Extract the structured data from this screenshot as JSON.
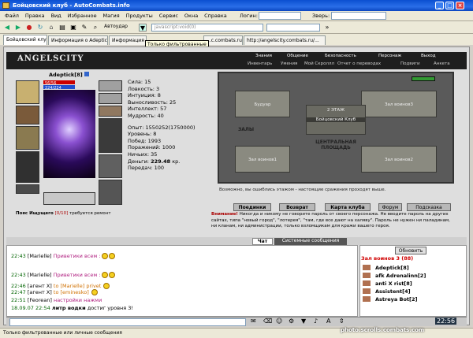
{
  "window": {
    "title": "Бойцовский клуб - AutoCombats.info"
  },
  "menu": [
    "Файл",
    "Правка",
    "Вид",
    "Избранное",
    "Магия",
    "Продукты",
    "Сервис",
    "Окна",
    "Справка"
  ],
  "toolbar": {
    "autoudar": "Автоудар",
    "url_placeholder": "javascript:void(0)",
    "login_label": "Логин:",
    "zver_label": "Зверь:"
  },
  "tabs": [
    "Бойцовский клуб",
    "Информация о Adeptick",
    "Информация о ...",
    "...c.combats.ru/...",
    "http://angelscity.combats.ru/..."
  ],
  "tooltip": "Только фильтрованные",
  "game_header": {
    "logo": "ANGELSCITY",
    "nav_top": [
      "Знания",
      "Общение",
      "Безопасность",
      "Персонаж",
      "Выход"
    ],
    "nav_bottom": [
      "Инвентарь",
      "Умения",
      "Мой Скроллл",
      "Отчет о переводах",
      "Подвиги",
      "Анкета"
    ]
  },
  "character": {
    "name": "Adeptick",
    "level": "[8]",
    "hp": "56/56",
    "mp": "224/224"
  },
  "stats": {
    "sila": "Сила: 15",
    "lovkost": "Ловкость: 3",
    "intuicia": "Интуиция: 8",
    "vynoslivost": "Выносливость: 25",
    "intellekt": "Интеллект: 57",
    "mudrost": "Мудрость: 40",
    "opyt": "Опыт: 1550252(1750000)",
    "uroven": "Уровень: 8",
    "pobed": "Побед: 1993",
    "porazheniy": "Поражений: 1000",
    "nichih": "Ничьих: 35",
    "dengi_label": "Деньги:",
    "dengi_value": "229.48",
    "dengi_unit": "кр.",
    "peredach": "Передач: 100"
  },
  "map": {
    "buduar": "Будуар",
    "zal1": "Зал воинов1",
    "zal2": "Зал воинов2",
    "zal3": "Зал воинов3",
    "floor": "2 ЭТАЖ",
    "club": "Бойцовский Клуб",
    "zaly": "ЗАЛЫ",
    "square": "ЦЕНТРАЛЬНАЯ ПЛОЩАДЬ",
    "note": "Возможно, вы ошиблись этажом - настоящие сражения проходят выше."
  },
  "map_buttons": [
    "Поединки",
    "Возврат",
    "Карта клуба",
    "Форум",
    "Подсказка"
  ],
  "warning": {
    "bold": "Внимание!",
    "text": "Никогда и никому не говорите пароль от своего персонажа. Не вводите пароль на других сайтах, типа \"новый город\", \"лотерея\", \"там, где все дают на халяву\". Пароль не нужен ни паладинам, ни кланам, ни администрации, только взломщикам для кражи вашего героя."
  },
  "belt": {
    "label": "Пояс Ищущего",
    "count": "[0/10]",
    "note": "требуется ремонт"
  },
  "chat_tabs": {
    "chat": "Чат",
    "system": "Системные сообщения"
  },
  "chat": [
    {
      "time": "22:43",
      "nick": "[Marielle]",
      "text": "Приветики всем :"
    },
    {
      "time": "22:43",
      "nick": "[Marielle]",
      "text": "Приветики всем :"
    },
    {
      "time": "22:46",
      "nick": "[агент X]",
      "to": "to [Marielle]",
      "text": "privet"
    },
    {
      "time": "22:47",
      "nick": "[агент X]",
      "to": "to [eminesko]",
      "text": ""
    },
    {
      "time": "22:51",
      "nick": "[Feorean]",
      "text": "настройки нажми"
    },
    {
      "time": "18.09.07 22:54",
      "nick": "литр водки",
      "text": "достиг уровня 3!"
    }
  ],
  "users": {
    "refresh": "Обновить",
    "room": "Зал воинов 3 (88)",
    "list": [
      "Adeptick[8]",
      "afk Adrenalinn[2]",
      "anti X rist[8]",
      "Assistent[4]",
      "Astreya Bot[2]"
    ]
  },
  "clock": "22:56",
  "status_text": "Только фильтрованные или личные сообщения",
  "watermark": "photo.scrolls.combats.com",
  "colors": {
    "titlebar": "#0a4fd1",
    "chat_time": "#006400",
    "chat_highlight": "#b02080",
    "room_title": "#d00000"
  }
}
